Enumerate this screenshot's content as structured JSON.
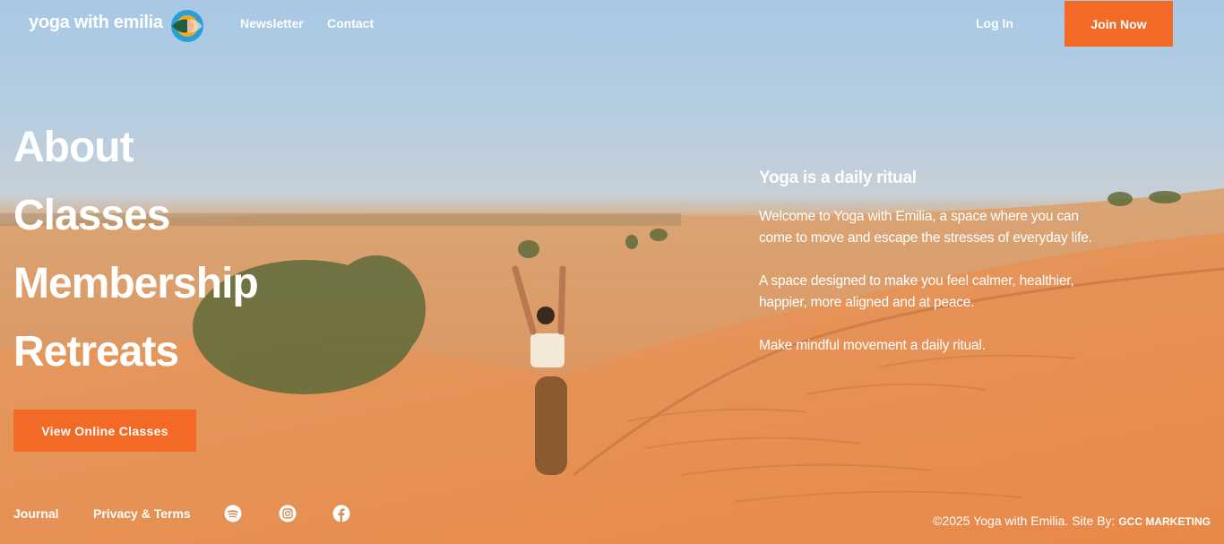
{
  "header": {
    "brand": "yoga with emilia",
    "nav": {
      "newsletter": "Newsletter",
      "contact": "Contact",
      "login": "Log In",
      "join": "Join Now"
    }
  },
  "menu": {
    "items": [
      "About",
      "Classes",
      "Membership",
      "Retreats"
    ],
    "cta": "View Online Classes"
  },
  "intro": {
    "heading": "Yoga is a daily ritual",
    "paragraphs": [
      "Welcome to Yoga with Emilia, a space where you can come to move and escape the stresses of everyday life.",
      "A space designed to make you feel calmer, healthier, happier, more aligned and at peace.",
      "Make mindful movement a daily ritual."
    ]
  },
  "footer": {
    "journal": "Journal",
    "privacy": "Privacy & Terms",
    "social_icons": [
      "spotify-icon",
      "instagram-icon",
      "facebook-icon"
    ],
    "copyright": "©2025 Yoga with Emilia. Site By:",
    "site_by": "GCC MARKETING"
  },
  "colors": {
    "accent": "#f26a25"
  }
}
